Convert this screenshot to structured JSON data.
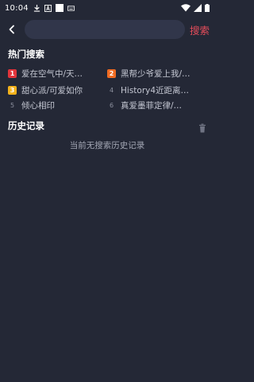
{
  "status_bar": {
    "time": "10:04"
  },
  "search": {
    "placeholder": "",
    "button_label": "搜索"
  },
  "hot": {
    "title": "热门搜索",
    "items": [
      {
        "rank": "1",
        "label": "爱在空气中/天…",
        "color": "#e2343b"
      },
      {
        "rank": "2",
        "label": "黑帮少爷爱上我/…",
        "color": "#f06b22"
      },
      {
        "rank": "3",
        "label": "甜心派/可爱如你",
        "color": "#f3b21c"
      },
      {
        "rank": "4",
        "label": "History4近距离…",
        "color": ""
      },
      {
        "rank": "5",
        "label": "倾心相印",
        "color": ""
      },
      {
        "rank": "6",
        "label": "真爱墨菲定律/…",
        "color": ""
      }
    ]
  },
  "history": {
    "title": "历史记录",
    "empty_text": "当前无搜索历史记录"
  },
  "colors": {
    "background": "#242836",
    "accent": "#e44c5a"
  }
}
